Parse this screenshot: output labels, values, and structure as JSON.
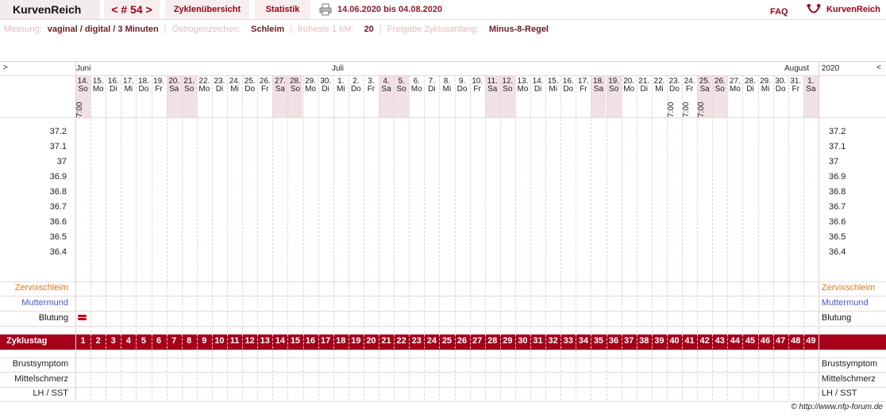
{
  "header": {
    "brand": "KurvenReich",
    "cycle_nav": "< # 54 >",
    "tab_overview": "Zyklenübersicht",
    "tab_stats": "Statistik",
    "date_range": "14.06.2020 bis 04.08.2020",
    "faq": "FAQ",
    "logo_text": "KurvenReich"
  },
  "info": {
    "measure_label": "Messung:",
    "measure_value": "vaginal / digital / 3 Minuten",
    "estrogen_label": "Östrogenzeichen:",
    "estrogen_value": "Schleim",
    "earliest_label": "früheste 1.hM:",
    "earliest_value": "20",
    "release_label": "Freigabe Zyklusanfang:",
    "release_value": "Minus-8-Regel"
  },
  "months": {
    "june": "Juni",
    "july": "Juli",
    "august": "August",
    "year": "2020",
    "left_arrow": ">",
    "right_arrow": "<"
  },
  "days": [
    {
      "d": "14.",
      "w": "So",
      "t": "7:00"
    },
    {
      "d": "15.",
      "w": "Mo"
    },
    {
      "d": "16.",
      "w": "Di"
    },
    {
      "d": "17.",
      "w": "Mi"
    },
    {
      "d": "18.",
      "w": "Do"
    },
    {
      "d": "19.",
      "w": "Fr"
    },
    {
      "d": "20.",
      "w": "Sa"
    },
    {
      "d": "21.",
      "w": "So"
    },
    {
      "d": "22.",
      "w": "Mo"
    },
    {
      "d": "23.",
      "w": "Di"
    },
    {
      "d": "24.",
      "w": "Mi"
    },
    {
      "d": "25.",
      "w": "Do"
    },
    {
      "d": "26.",
      "w": "Fr"
    },
    {
      "d": "27.",
      "w": "Sa"
    },
    {
      "d": "28.",
      "w": "So"
    },
    {
      "d": "29.",
      "w": "Mo"
    },
    {
      "d": "30.",
      "w": "Di"
    },
    {
      "d": "1.",
      "w": "Mi"
    },
    {
      "d": "2.",
      "w": "Do"
    },
    {
      "d": "3.",
      "w": "Fr"
    },
    {
      "d": "4.",
      "w": "Sa"
    },
    {
      "d": "5.",
      "w": "So"
    },
    {
      "d": "6.",
      "w": "Mo"
    },
    {
      "d": "7.",
      "w": "Di"
    },
    {
      "d": "8.",
      "w": "Mi"
    },
    {
      "d": "9.",
      "w": "Do"
    },
    {
      "d": "10.",
      "w": "Fr"
    },
    {
      "d": "11.",
      "w": "Sa"
    },
    {
      "d": "12.",
      "w": "So"
    },
    {
      "d": "13.",
      "w": "Mo"
    },
    {
      "d": "14.",
      "w": "Di"
    },
    {
      "d": "15.",
      "w": "Mi"
    },
    {
      "d": "16.",
      "w": "Do"
    },
    {
      "d": "17.",
      "w": "Fr"
    },
    {
      "d": "18.",
      "w": "Sa"
    },
    {
      "d": "19.",
      "w": "So"
    },
    {
      "d": "20.",
      "w": "Mo"
    },
    {
      "d": "21.",
      "w": "Di"
    },
    {
      "d": "22.",
      "w": "Mi"
    },
    {
      "d": "23.",
      "w": "Do",
      "t": "7:00"
    },
    {
      "d": "24.",
      "w": "Fr",
      "t": "7:00"
    },
    {
      "d": "25.",
      "w": "Sa",
      "t": "7:00"
    },
    {
      "d": "26.",
      "w": "So"
    },
    {
      "d": "27.",
      "w": "Mo"
    },
    {
      "d": "28.",
      "w": "Di"
    },
    {
      "d": "29.",
      "w": "Mi"
    },
    {
      "d": "30.",
      "w": "Do"
    },
    {
      "d": "31.",
      "w": "Fr"
    },
    {
      "d": "1.",
      "w": "Sa"
    }
  ],
  "temperatures": [
    "37.2",
    "37.1",
    "37",
    "36.9",
    "36.8",
    "36.7",
    "36.6",
    "36.5",
    "36.4"
  ],
  "rows": {
    "cervix": "Zervixschleim",
    "cervix_color": "#e07a10",
    "muttermund": "Muttermund",
    "muttermund_color": "#4a5ad0",
    "blutung": "Blutung",
    "zyklustag": "Zyklustag",
    "brust": "Brustsymptom",
    "mittel": "Mittelschmerz",
    "lh": "LH / SST"
  },
  "cycle_days": [
    "1",
    "2",
    "3",
    "4",
    "5",
    "6",
    "7",
    "8",
    "9",
    "10",
    "11",
    "12",
    "13",
    "14",
    "15",
    "16",
    "17",
    "18",
    "19",
    "20",
    "21",
    "22",
    "23",
    "24",
    "25",
    "26",
    "27",
    "28",
    "29",
    "30",
    "31",
    "32",
    "33",
    "34",
    "35",
    "36",
    "37",
    "38",
    "39",
    "40",
    "41",
    "42",
    "43",
    "44",
    "45",
    "46",
    "47",
    "48",
    "49"
  ],
  "bleeding_day": 1,
  "footer": "© http://www.nfp-forum.de",
  "colors": {
    "accent": "#a6001a",
    "weekend": "#f1e1e4"
  }
}
